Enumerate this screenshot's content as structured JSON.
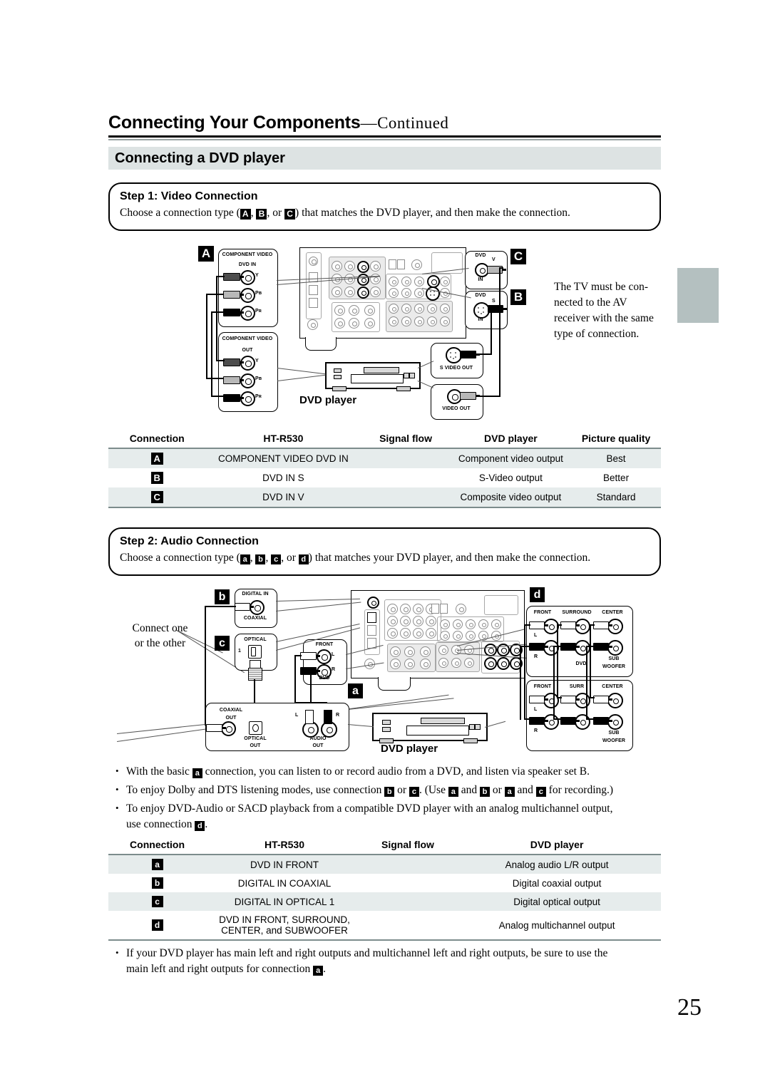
{
  "header": {
    "title_main": "Connecting Your Components",
    "title_cont": "—Continued",
    "section_title": "Connecting a DVD player"
  },
  "step1": {
    "heading": "Step 1: Video Connection",
    "text_before": "Choose a connection type (",
    "tag_a": "A",
    "sep1": ", ",
    "tag_b": "B",
    "sep2": ", or ",
    "tag_c": "C",
    "text_after": ") that matches the DVD player, and then make the connection."
  },
  "step2": {
    "heading": "Step 2: Audio Connection",
    "text_before": "Choose a connection type (",
    "tag_a": "a",
    "sep1": ", ",
    "tag_b": "b",
    "sep2": ", ",
    "tag_c": "c",
    "sep3": ", or ",
    "tag_d": "d",
    "text_after": ") that matches your DVD player, and then make the connection."
  },
  "video_diagram": {
    "label_A": "A",
    "label_B": "B",
    "label_C": "C",
    "note": "The TV must be connected to the AV receiver with the same type of connection.",
    "note_lines": [
      "The TV must be con-",
      "nected to the AV",
      "receiver with the same",
      "type of connection."
    ],
    "recv_comp_in": {
      "title": "COMPONENT VIDEO",
      "sub": "DVD IN",
      "jacks": [
        "Y",
        "Pʙ",
        "Pʀ"
      ]
    },
    "dvd_comp_out": {
      "title": "COMPONENT VIDEO",
      "sub": "OUT",
      "jacks": [
        "Y",
        "Pʙ",
        "Pʀ"
      ]
    },
    "recv_dvd_v": {
      "top": "DVD",
      "side": "V",
      "bottom": "IN"
    },
    "recv_dvd_s": {
      "top": "DVD",
      "side": "S",
      "bottom": "IN"
    },
    "dvd_s_out": "S VIDEO OUT",
    "dvd_v_out": "VIDEO OUT",
    "device_label": "DVD player"
  },
  "table1": {
    "headers": [
      "Connection",
      "HT-R530",
      "Signal flow",
      "DVD player",
      "Picture quality"
    ],
    "rows": [
      {
        "tag": "A",
        "htr530": "COMPONENT VIDEO DVD IN",
        "flow": "",
        "dvd": "Component video output",
        "quality": "Best"
      },
      {
        "tag": "B",
        "htr530": "DVD IN S",
        "flow": "",
        "dvd": "S-Video output",
        "quality": "Better"
      },
      {
        "tag": "C",
        "htr530": "DVD IN V",
        "flow": "",
        "dvd": "Composite video output",
        "quality": "Standard"
      }
    ]
  },
  "audio_diagram": {
    "label_a": "a",
    "label_b": "b",
    "label_c": "c",
    "label_d": "d",
    "connect_note_lines": [
      "Connect one",
      "or the other"
    ],
    "recv_digital_in": {
      "title": "DIGITAL IN",
      "bottom": "COAXIAL"
    },
    "recv_optical": {
      "title": "OPTICAL",
      "num": "1"
    },
    "recv_front": {
      "title": "FRONT",
      "l": "L",
      "r": "R",
      "bottom": "DVD"
    },
    "dvd_outputs": {
      "coaxial": "COAXIAL\nOUT",
      "coaxial_l1": "COAXIAL",
      "coaxial_l2": "OUT",
      "optical_l1": "OPTICAL",
      "optical_l2": "OUT",
      "audio_l1": "AUDIO",
      "audio_l2": "OUT",
      "l": "L",
      "r": "R"
    },
    "multi_recv": {
      "front": "FRONT",
      "surround": "SURROUND",
      "center": "CENTER",
      "l": "L",
      "r": "R",
      "dvd": "DVD",
      "sub1": "SUB",
      "sub2": "WOOFER"
    },
    "multi_dvd": {
      "front": "FRONT",
      "surr": "SURR",
      "center": "CENTER",
      "l": "L",
      "r": "R",
      "sub1": "SUB",
      "sub2": "WOOFER"
    },
    "device_label": "DVD player"
  },
  "notes": {
    "b1_p1": "With the basic ",
    "b1_tag": "a",
    "b1_p2": " connection, you can listen to or record audio from a DVD, and listen via speaker set B.",
    "b2_p1": "To enjoy Dolby and DTS listening modes, use connection ",
    "b2_t1": "b",
    "b2_p2": " or ",
    "b2_t2": "c",
    "b2_p3": ". (Use ",
    "b2_t3": "a",
    "b2_p4": " and ",
    "b2_t4": "b",
    "b2_p5": " or ",
    "b2_t5": "a",
    "b2_p6": " and ",
    "b2_t6": "c",
    "b2_p7": " for recording.)",
    "b3_p1": "To enjoy DVD-Audio or SACD playback from a compatible DVD player with an analog multichannel output,",
    "b3_p2": "use connection ",
    "b3_tag": "d",
    "b3_p3": "."
  },
  "table2": {
    "headers": [
      "Connection",
      "HT-R530",
      "Signal flow",
      "DVD player"
    ],
    "rows": [
      {
        "tag": "a",
        "htr530": "DVD IN FRONT",
        "htr530_2": "",
        "flow": "",
        "dvd": "Analog audio L/R output"
      },
      {
        "tag": "b",
        "htr530": "DIGITAL IN COAXIAL",
        "htr530_2": "",
        "flow": "",
        "dvd": "Digital coaxial output"
      },
      {
        "tag": "c",
        "htr530": "DIGITAL IN OPTICAL 1",
        "htr530_2": "",
        "flow": "",
        "dvd": "Digital optical output"
      },
      {
        "tag": "d",
        "htr530": "DVD IN FRONT, SURROUND,",
        "htr530_2": "CENTER, and SUBWOOFER",
        "flow": "",
        "dvd": "Analog multichannel output"
      }
    ]
  },
  "footnote": {
    "l1": "If your DVD player has main left and right outputs and multichannel left and right outputs, be sure to use the",
    "l2_p1": "main left and right outputs for connection ",
    "l2_tag": "a",
    "l2_p2": "."
  },
  "page_number": "25"
}
